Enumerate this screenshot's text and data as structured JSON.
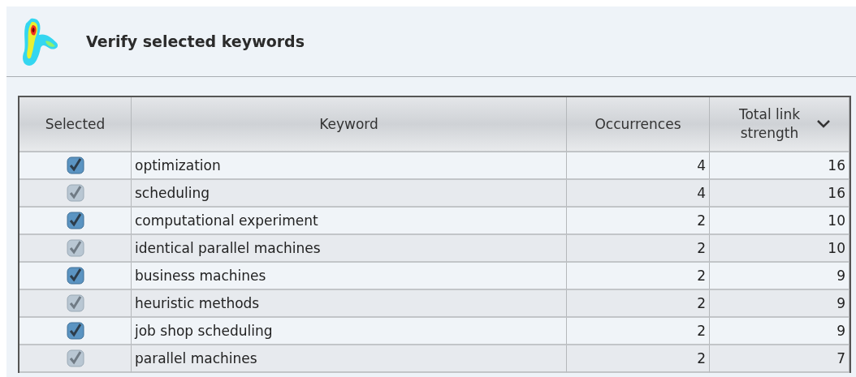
{
  "header": {
    "title": "Verify selected keywords"
  },
  "table": {
    "columns": [
      {
        "label": "Selected",
        "sorted": false
      },
      {
        "label": "Keyword",
        "sorted": false
      },
      {
        "label": "Occurrences",
        "sorted": false
      },
      {
        "label": "Total link strength",
        "sorted": true
      }
    ],
    "rows": [
      {
        "checked": true,
        "keyword": "optimization",
        "occurrences": "4",
        "total_link_strength": "16"
      },
      {
        "checked": true,
        "keyword": "scheduling",
        "occurrences": "4",
        "total_link_strength": "16"
      },
      {
        "checked": true,
        "keyword": "computational experiment",
        "occurrences": "2",
        "total_link_strength": "10"
      },
      {
        "checked": true,
        "keyword": "identical parallel machines",
        "occurrences": "2",
        "total_link_strength": "10"
      },
      {
        "checked": true,
        "keyword": "business machines",
        "occurrences": "2",
        "total_link_strength": "9"
      },
      {
        "checked": true,
        "keyword": "heuristic methods",
        "occurrences": "2",
        "total_link_strength": "9"
      },
      {
        "checked": true,
        "keyword": "job shop scheduling",
        "occurrences": "2",
        "total_link_strength": "9"
      },
      {
        "checked": true,
        "keyword": "parallel machines",
        "occurrences": "2",
        "total_link_strength": "7"
      }
    ]
  }
}
